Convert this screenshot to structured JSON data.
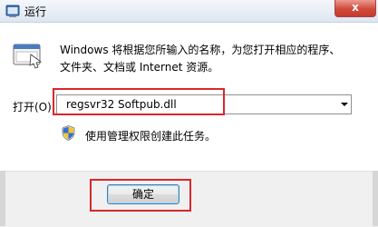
{
  "window": {
    "title": "运行",
    "close_label": "x"
  },
  "description": {
    "line1": "Windows 将根据您所输入的名称，为您打开相应的程序、",
    "line2": "文件夹、文档或 Internet 资源。"
  },
  "open_field": {
    "label": "打开(O):",
    "value": "regsvr32 Softpub.dll"
  },
  "admin_notice": "使用管理权限创建此任务。",
  "buttons": {
    "ok_label": "确定"
  },
  "colors": {
    "highlight": "#d9262c",
    "footer_bg": "#f0f0f0",
    "titlebar": "#dde6f1"
  },
  "icons": {
    "title": "run-icon",
    "program": "run-program-icon",
    "admin": "uac-shield-icon"
  }
}
